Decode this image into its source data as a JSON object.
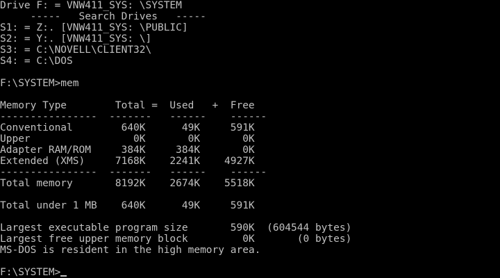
{
  "colors": {
    "background": "#000000",
    "text": "#c0c0c0"
  },
  "lines": [
    "Drive F: = VNW411_SYS: \\SYSTEM",
    "     -----   Search Drives   -----",
    "S1: = Z:. [VNW411_SYS: \\PUBLIC]",
    "S2: = Y:. [VNW411_SYS: \\]",
    "S3: = C:\\NOVELL\\CLIENT32\\",
    "S4: = C:\\DOS",
    "",
    "F:\\SYSTEM>mem",
    "",
    "Memory Type        Total =  Used   +  Free",
    "----------------  -------   ------    ------",
    "Conventional        640K      49K     591K",
    "Upper                 0K       0K       0K",
    "Adapter RAM/ROM     384K     384K       0K",
    "Extended (XMS)     7168K    2241K    4927K",
    "----------------  -------   ------    ------",
    "Total memory       8192K    2674K    5518K",
    "",
    "Total under 1 MB    640K      49K     591K",
    "",
    "Largest executable program size       590K  (604544 bytes)",
    "Largest free upper memory block         0K       (0 bytes)",
    "MS-DOS is resident in the high memory area.",
    ""
  ],
  "prompt": "F:\\SYSTEM>"
}
